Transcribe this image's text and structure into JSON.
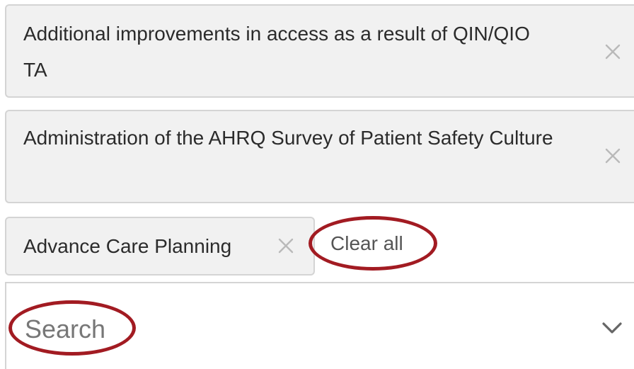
{
  "filter": {
    "selected": [
      {
        "label": "Additional improvements in access as a result of QIN/QIO TA",
        "remove_icon": "close-icon"
      },
      {
        "label": "Administration of the AHRQ Survey of Patient Safety Culture",
        "remove_icon": "close-icon"
      },
      {
        "label": "Advance Care Planning",
        "remove_icon": "close-icon"
      }
    ],
    "clear_all_label": "Clear all",
    "search": {
      "placeholder": "Search",
      "value": ""
    },
    "dropdown_icon": "chevron-down-icon"
  },
  "colors": {
    "chip_background": "#f1f1f1",
    "chip_border": "#d4d4d4",
    "annotation_ring": "#a21b22",
    "placeholder_text": "#777777"
  }
}
